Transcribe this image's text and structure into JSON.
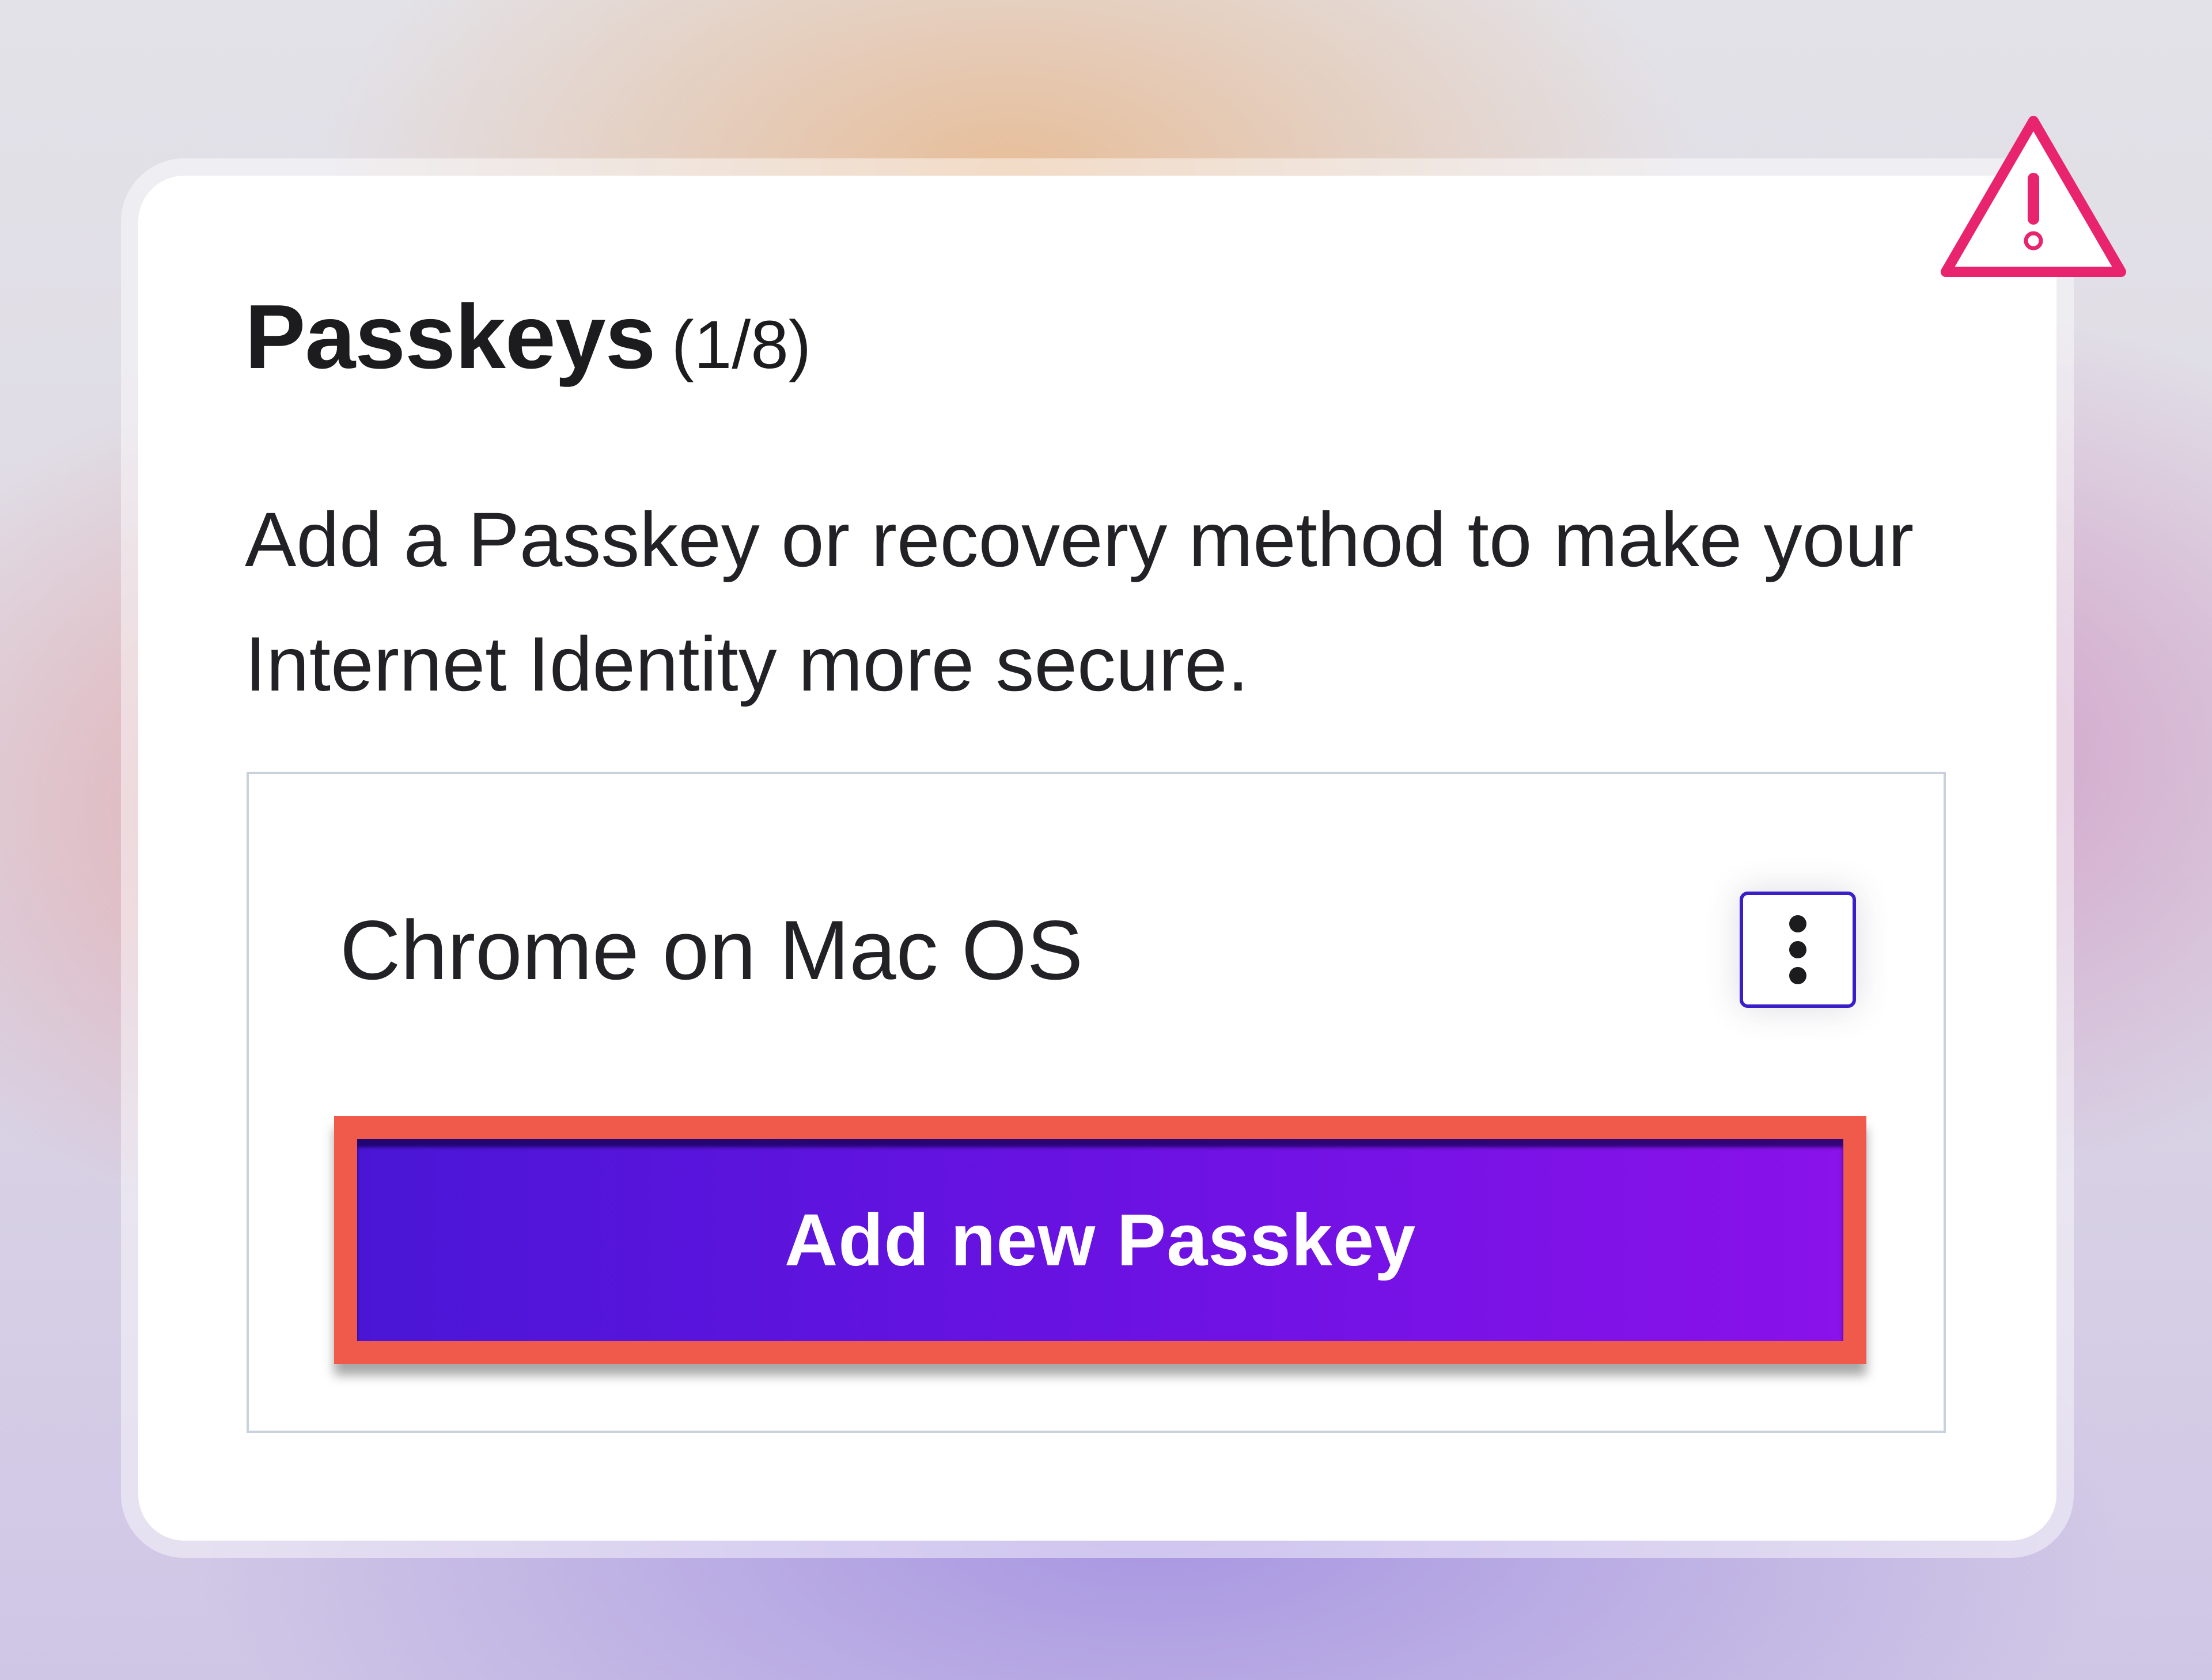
{
  "section": {
    "title": "Passkeys",
    "count": "(1/8)",
    "description": "Add a Passkey or recovery method to make your Internet Identity more secure."
  },
  "passkeys": [
    {
      "name": "Chrome on Mac OS",
      "menu_icon": "vertical-ellipsis-icon"
    }
  ],
  "actions": {
    "add_label": "Add new Passkey"
  },
  "icons": {
    "warning": "warning-triangle-icon"
  },
  "colors": {
    "warning": "#e8246e",
    "button_gradient_start": "#4a16d6",
    "button_gradient_end": "#8a12ea",
    "highlight_outline": "#f05a4a",
    "menu_border": "#3a1fc9"
  }
}
